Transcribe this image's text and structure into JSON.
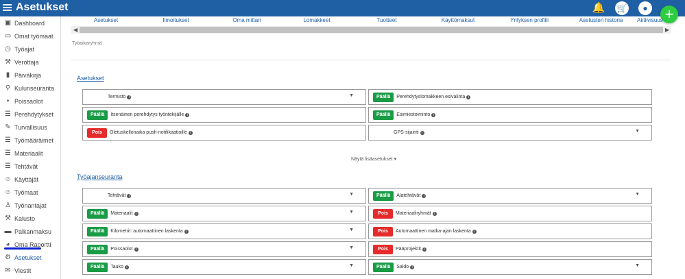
{
  "app": {
    "title": "Asetukset"
  },
  "topbar": {
    "icons": [
      "bell-icon",
      "cart-icon",
      "user-icon"
    ],
    "add_label": "+"
  },
  "sidebar": {
    "items": [
      {
        "label": "Dashboard",
        "icon": "dashboard-icon"
      },
      {
        "label": "Omat työmaat",
        "icon": "folder-icon"
      },
      {
        "label": "Työajat",
        "icon": "clock-icon"
      },
      {
        "label": "Verottaja",
        "icon": "hammer-icon"
      },
      {
        "label": "Päiväkirja",
        "icon": "book-icon"
      },
      {
        "label": "Kulunseuranta",
        "icon": "pin-icon"
      },
      {
        "label": "Poissaolot",
        "icon": "coffee-icon"
      },
      {
        "label": "Perehdytykset",
        "icon": "checklist-icon"
      },
      {
        "label": "Turvallisuus",
        "icon": "pen-icon"
      },
      {
        "label": "Työmääräimet",
        "icon": "list-icon"
      },
      {
        "label": "Materiaalit",
        "icon": "list-icon"
      },
      {
        "label": "Tehtävät",
        "icon": "list-icon"
      },
      {
        "label": "Käyttäjät",
        "icon": "users-icon"
      },
      {
        "label": "Työmaat",
        "icon": "user-icon"
      },
      {
        "label": "Työnantajat",
        "icon": "person-icon"
      },
      {
        "label": "Kalusto",
        "icon": "hammer-icon"
      },
      {
        "label": "Palkanmaksu",
        "icon": "money-icon"
      },
      {
        "label": "Oma Raportti",
        "icon": "pie-icon"
      },
      {
        "label": "Asetukset",
        "icon": "gear-icon"
      },
      {
        "label": "Viestit",
        "icon": "message-icon"
      }
    ]
  },
  "tabs": [
    "Asetukset",
    "Ilmoitukset",
    "Oma mittari",
    "Lomakkeet",
    "Tuotteet",
    "Käyttömaksut",
    "Yrityksen profiili",
    "Asetusten historia",
    "Aktiivisuus"
  ],
  "active_tab": "Tuotteet",
  "group_label": "Työaikaryhmä",
  "sections": {
    "asetukset": {
      "title": "Asetukset",
      "left": [
        {
          "badge": "",
          "label": "Termistö",
          "dropdown": true
        },
        {
          "badge": "Päällä",
          "label": "Itsenäinen perehdytys työntekijälle",
          "dropdown": false
        },
        {
          "badge": "Pois",
          "label": "Oletuskellonaika push-notifikaatioille",
          "dropdown": false
        }
      ],
      "right": [
        {
          "badge": "Päällä",
          "label": "Perehdytyslomakkeen esivalinta",
          "dropdown": false
        },
        {
          "badge": "Päällä",
          "label": "Esimiestoiminto",
          "dropdown": false
        },
        {
          "badge": "",
          "label": "GPS-sijainti",
          "dropdown": true
        }
      ]
    },
    "more_label": "Näytä lisäasetukset ▾",
    "tyoajanseuranta": {
      "title": "Työajanseuranta",
      "left": [
        {
          "badge": "",
          "label": "Tehtävät",
          "dropdown": true
        },
        {
          "badge": "Päällä",
          "label": "Materiaalit",
          "dropdown": true
        },
        {
          "badge": "Päällä",
          "label": "Kilometrit: automaattinen laskenta",
          "dropdown": true
        },
        {
          "badge": "Päällä",
          "label": "Poissaolot",
          "dropdown": true
        },
        {
          "badge": "Päällä",
          "label": "Tauko",
          "dropdown": true
        }
      ],
      "right": [
        {
          "badge": "Päällä",
          "label": "Alatehtävät",
          "dropdown": true
        },
        {
          "badge": "Pois",
          "label": "Materiaaliryhmät",
          "dropdown": false
        },
        {
          "badge": "Pois",
          "label": "Automaattinen matka-ajan laskenta",
          "dropdown": false
        },
        {
          "badge": "Pois",
          "label": "Pääprojektit",
          "dropdown": false
        },
        {
          "badge": "Päällä",
          "label": "Saldo",
          "dropdown": true
        }
      ]
    }
  },
  "colors": {
    "header": "#1f5fa4",
    "on": "#1a9b46",
    "off": "#e52b2b",
    "accent_underline": "#0a1fd0",
    "fab": "#2ecc40"
  }
}
